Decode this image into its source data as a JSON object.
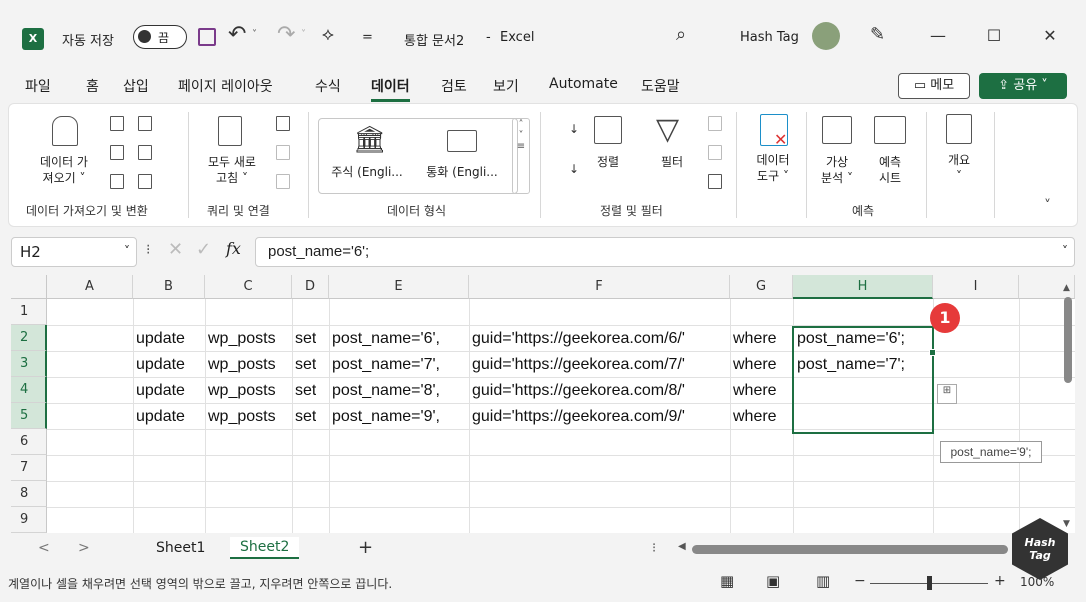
{
  "titlebar": {
    "autosave_label": "자동 저장",
    "autosave_state": "끔",
    "doc_title": "통합 문서2",
    "app_sep": "-",
    "app_name": "Excel",
    "user_name": "Hash Tag"
  },
  "menu": {
    "tabs": [
      "파일",
      "홈",
      "삽입",
      "페이지 레이아웃",
      "수식",
      "데이터",
      "검토",
      "보기",
      "Automate",
      "도움말"
    ],
    "active_tab": "데이터",
    "memo_label": "메모",
    "share_label": "공유"
  },
  "ribbon": {
    "get_data_label_1": "데이터 가",
    "get_data_label_2": "져오기 ˅",
    "refresh_label_1": "모두 새로",
    "refresh_label_2": "고침 ˅",
    "stocks_label": "주식 (Engli...",
    "currency_label": "통화 (Engli...",
    "sort_label": "정렬",
    "filter_label": "필터",
    "data_tools_label_1": "데이터",
    "data_tools_label_2": "도구 ˅",
    "whatif_label_1": "가상",
    "whatif_label_2": "분석 ˅",
    "forecast_label_1": "예측",
    "forecast_label_2": "시트",
    "outline_label": "개요",
    "groups": {
      "get_transform": "데이터 가져오기 및 변환",
      "queries": "쿼리 및 연결",
      "data_types": "데이터 형식",
      "sort_filter": "정렬 및 필터",
      "forecast": "예측"
    }
  },
  "formula_bar": {
    "name_box": "H2",
    "fx": "fx",
    "formula": "post_name='6';"
  },
  "grid": {
    "columns": [
      "A",
      "B",
      "C",
      "D",
      "E",
      "F",
      "G",
      "H",
      "I"
    ],
    "selected_column": "H",
    "rows": [
      "1",
      "2",
      "3",
      "4",
      "5",
      "6",
      "7",
      "8",
      "9"
    ],
    "data": [
      {
        "b": "update",
        "c": "wp_posts",
        "d": "set",
        "e": "post_name='6',",
        "f": "guid='https://geekorea.com/6/'",
        "g": "where",
        "h": "post_name='6';"
      },
      {
        "b": "update",
        "c": "wp_posts",
        "d": "set",
        "e": "post_name='7',",
        "f": "guid='https://geekorea.com/7/'",
        "g": "where",
        "h": "post_name='7';"
      },
      {
        "b": "update",
        "c": "wp_posts",
        "d": "set",
        "e": "post_name='8',",
        "f": "guid='https://geekorea.com/8/'",
        "g": "where",
        "h": ""
      },
      {
        "b": "update",
        "c": "wp_posts",
        "d": "set",
        "e": "post_name='9',",
        "f": "guid='https://geekorea.com/9/'",
        "g": "where",
        "h": ""
      }
    ],
    "fill_tooltip": "post_name='9';",
    "badge": "1"
  },
  "sheets": {
    "tabs": [
      "Sheet1",
      "Sheet2"
    ],
    "active": "Sheet2",
    "add": "+"
  },
  "status": {
    "message": "계열이나 셀을 채우려면 선택 영역의 밖으로 끌고, 지우려면 안쪽으로 끕니다.",
    "zoom": "100%"
  },
  "watermark": "Hash Tag",
  "colors": {
    "accent": "#1d6f42",
    "badge": "#e63a3a"
  }
}
